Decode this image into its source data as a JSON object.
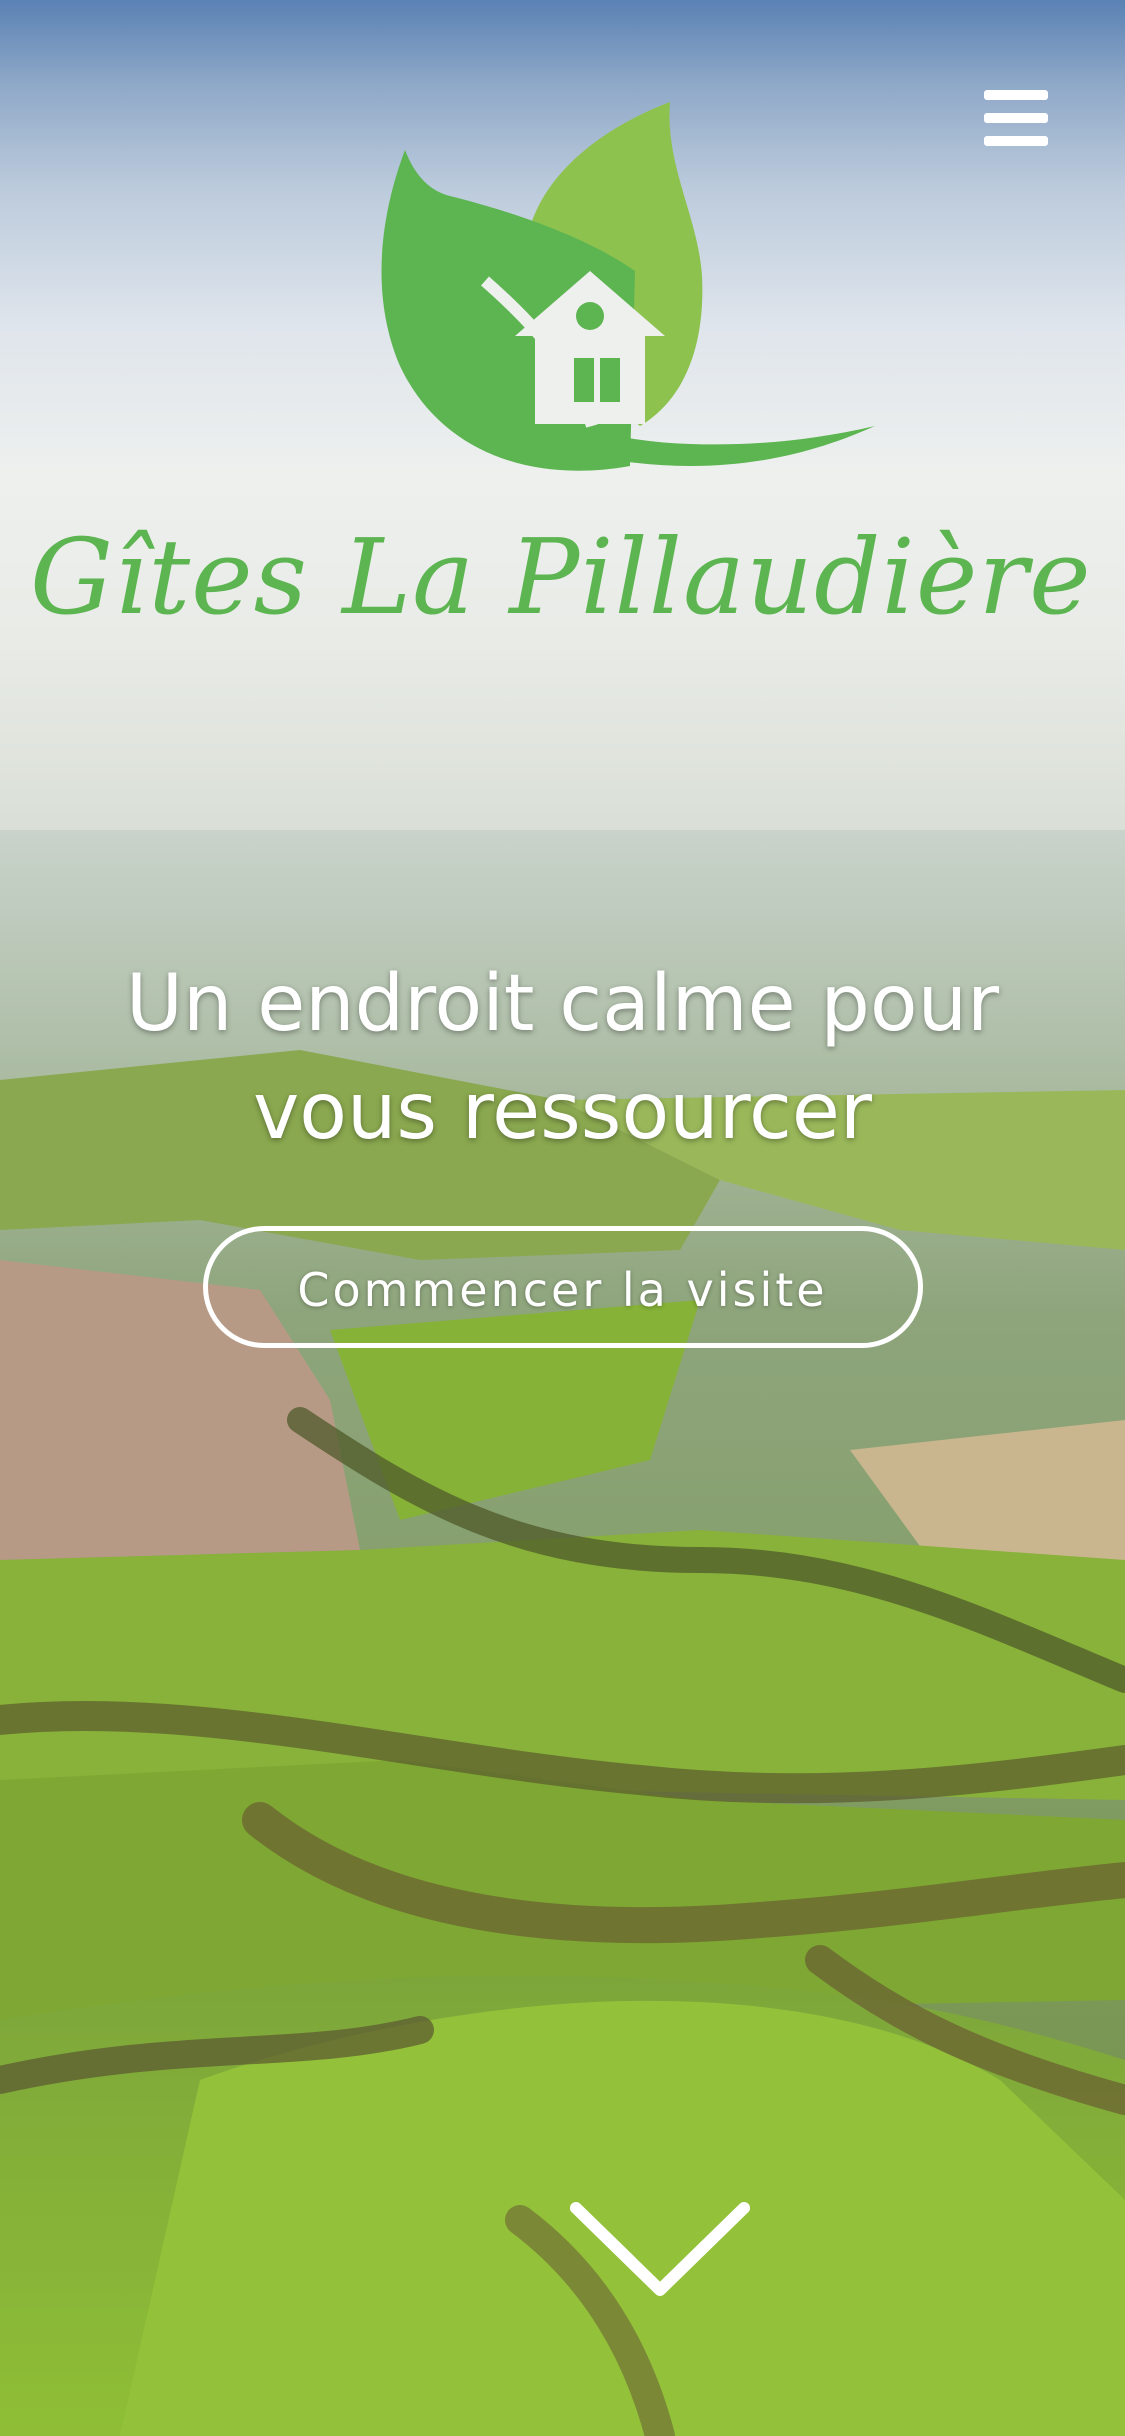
{
  "brand": {
    "name": "Gîtes La Pillaudière",
    "logo_icon": "leaf-house-icon",
    "color": "#5cb550"
  },
  "header": {
    "menu_icon": "hamburger-menu-icon"
  },
  "hero": {
    "tagline_line1": "Un endroit calme pour",
    "tagline_line2": "vous ressourcer",
    "cta_label": "Commencer la visite",
    "scroll_icon": "chevron-down-icon"
  }
}
